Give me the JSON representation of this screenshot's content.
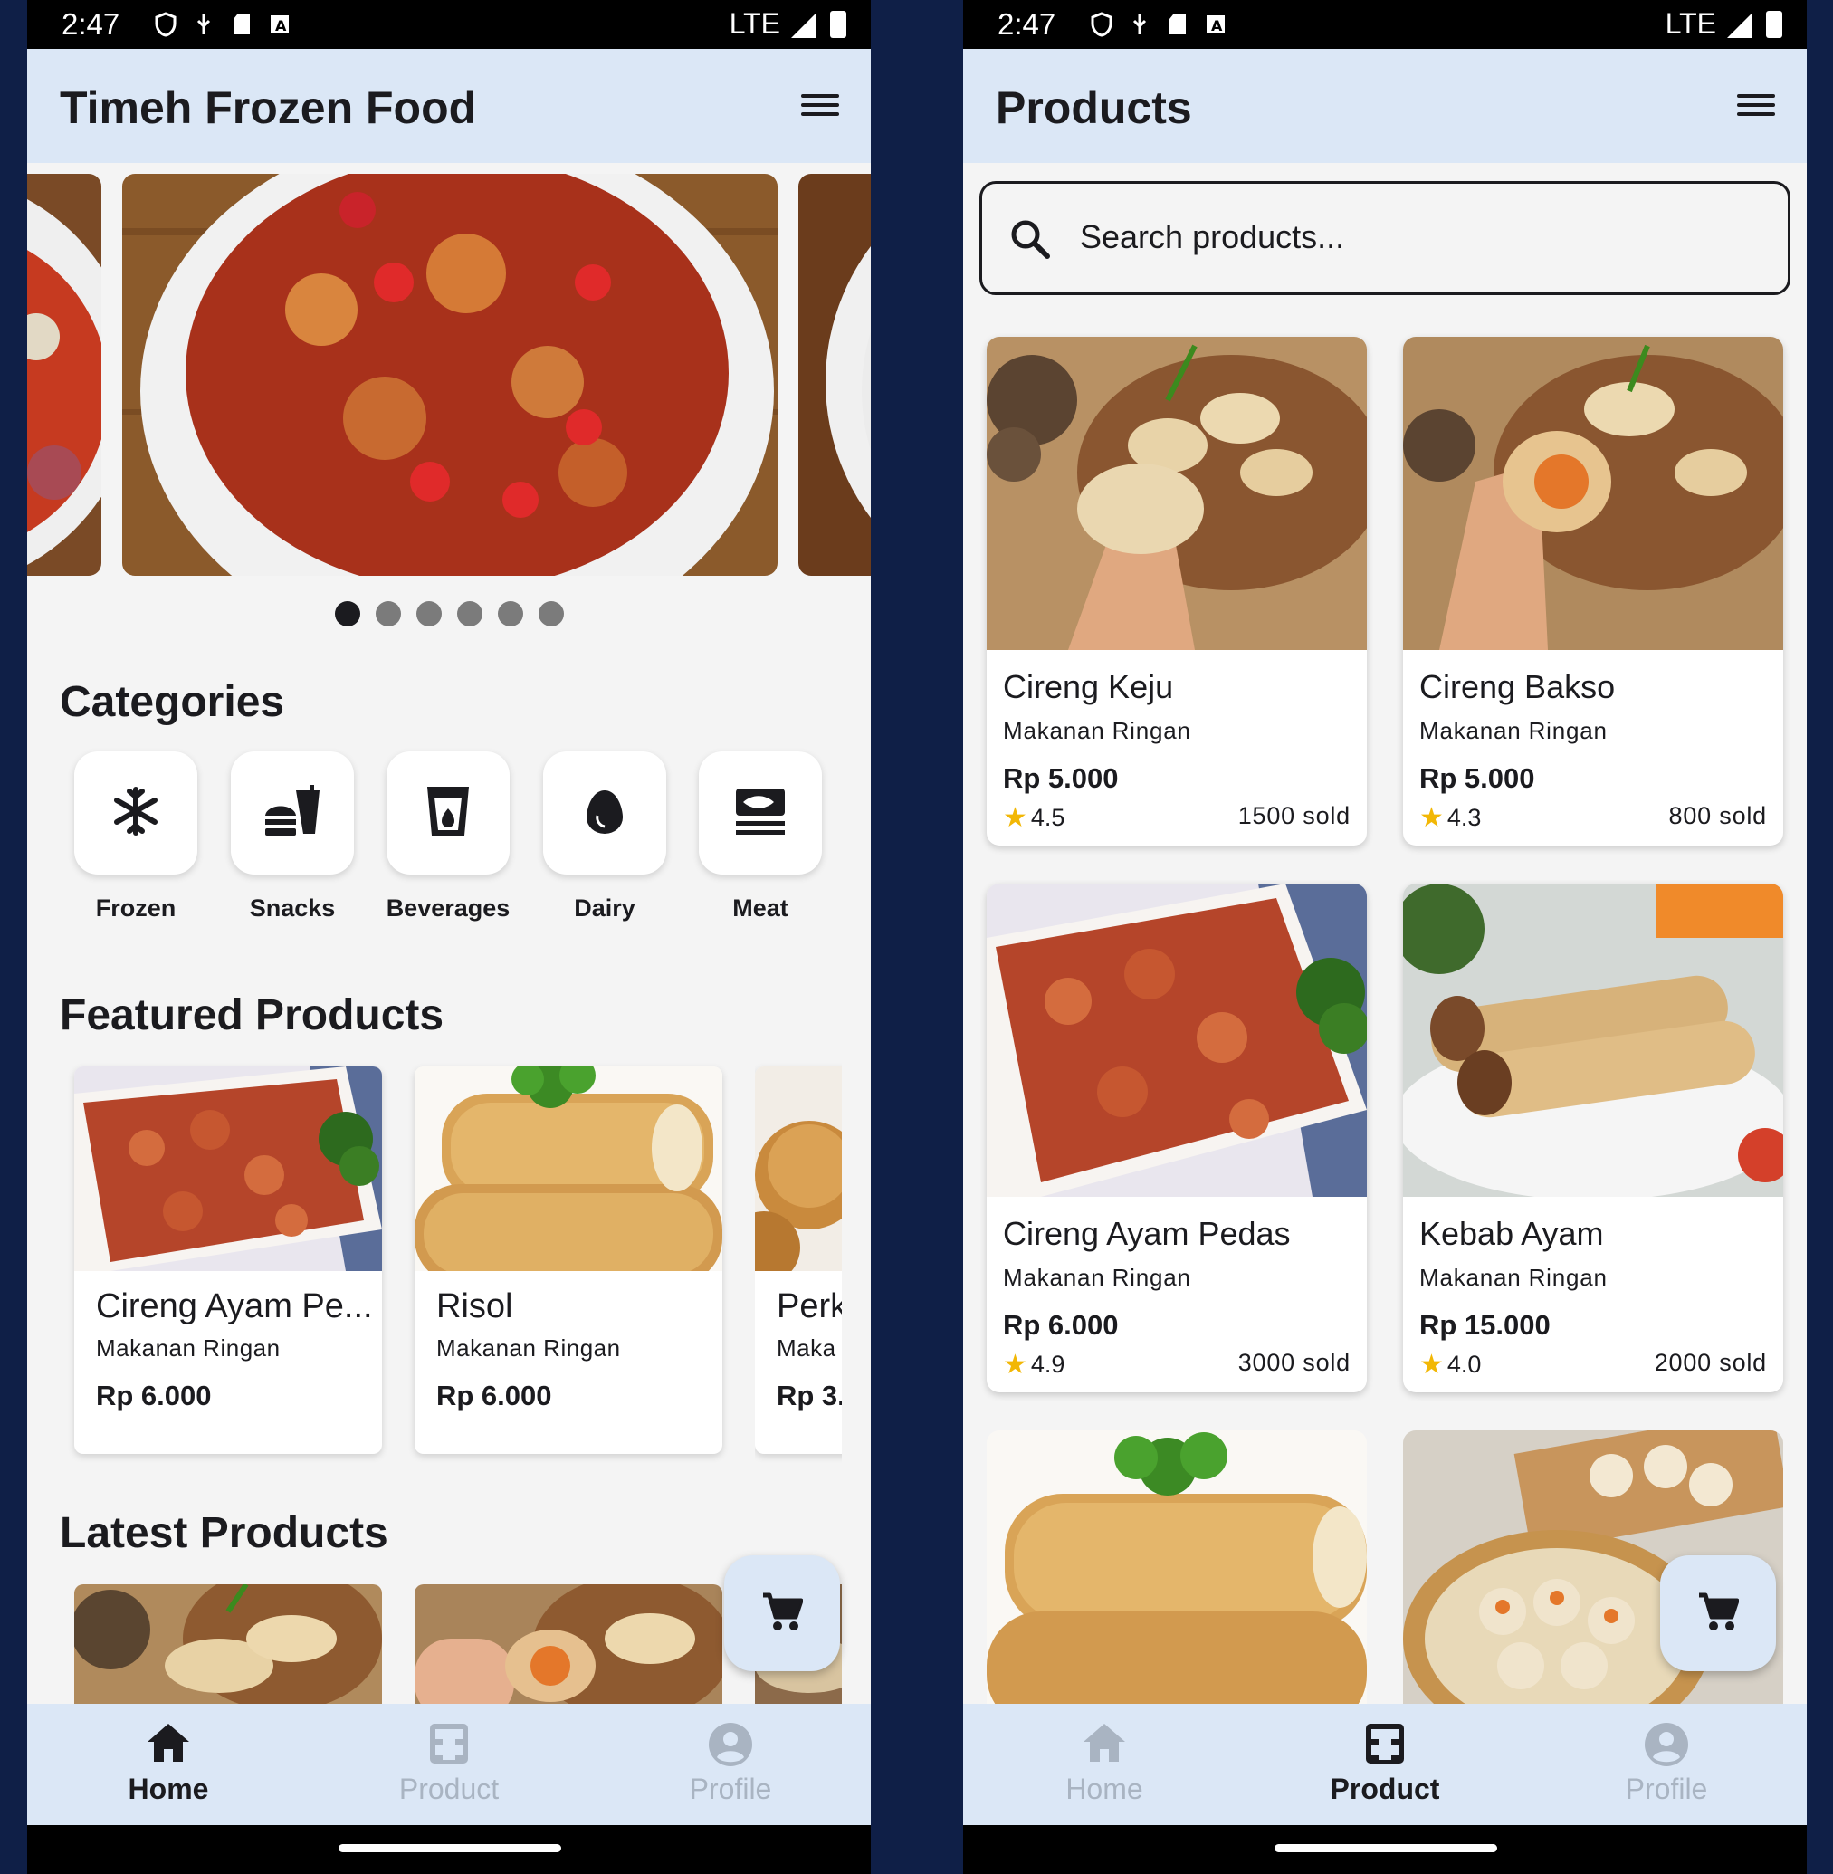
{
  "colors": {
    "app_bar": "#dbe7f6",
    "background": "#f4f4f4",
    "frame": "#0f1f47",
    "star": "#f2b705"
  },
  "status_bar": {
    "time": "2:47",
    "network": "LTE"
  },
  "home": {
    "title": "Timeh Frozen Food",
    "carousel": {
      "dot_count": 6,
      "active_index": 0
    },
    "categories_title": "Categories",
    "categories": [
      {
        "label": "Frozen",
        "icon": "snowflake-icon"
      },
      {
        "label": "Snacks",
        "icon": "fastfood-icon"
      },
      {
        "label": "Beverages",
        "icon": "drink-cup-icon"
      },
      {
        "label": "Dairy",
        "icon": "egg-icon"
      },
      {
        "label": "Meat",
        "icon": "set-meal-icon"
      }
    ],
    "featured_title": "Featured Products",
    "featured": [
      {
        "name": "Cireng Ayam Pe...",
        "category": "Makanan Ringan",
        "price": "Rp 6.000"
      },
      {
        "name": "Risol",
        "category": "Makanan Ringan",
        "price": "Rp 6.000"
      },
      {
        "name": "Perk",
        "category": "Maka",
        "price": "Rp 3."
      }
    ],
    "latest_title": "Latest Products"
  },
  "products_page": {
    "title": "Products",
    "search_placeholder": "Search products...",
    "items": [
      {
        "name": "Cireng Keju",
        "category": "Makanan Ringan",
        "price": "Rp 5.000",
        "rating": "4.5",
        "sold": "1500 sold"
      },
      {
        "name": "Cireng Bakso",
        "category": "Makanan Ringan",
        "price": "Rp 5.000",
        "rating": "4.3",
        "sold": "800 sold"
      },
      {
        "name": "Cireng Ayam Pedas",
        "category": "Makanan Ringan",
        "price": "Rp 6.000",
        "rating": "4.9",
        "sold": "3000 sold"
      },
      {
        "name": "Kebab Ayam",
        "category": "Makanan Ringan",
        "price": "Rp 15.000",
        "rating": "4.0",
        "sold": "2000 sold"
      }
    ]
  },
  "nav": {
    "home": "Home",
    "product": "Product",
    "profile": "Profile"
  }
}
